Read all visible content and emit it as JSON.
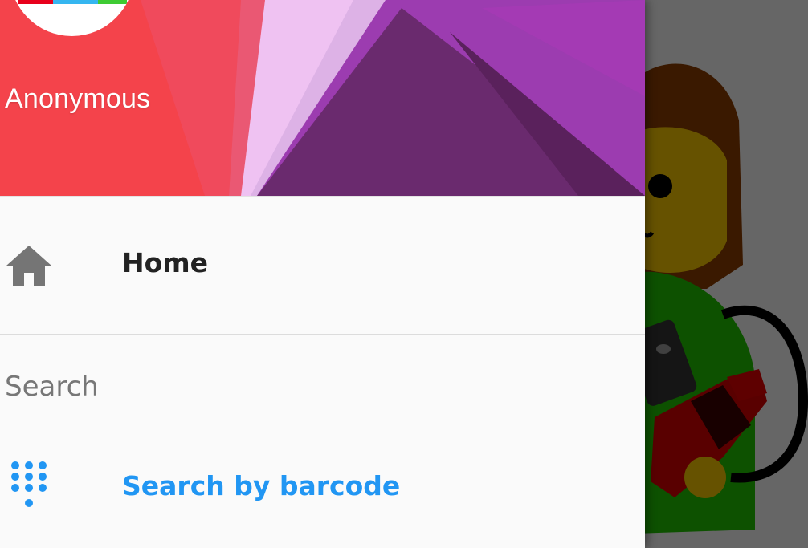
{
  "drawer": {
    "header": {
      "user_name": "Anonymous"
    },
    "items": {
      "home": {
        "label": "Home",
        "icon": "home-icon"
      },
      "search_section": {
        "label": "Search"
      },
      "search_by_barcode": {
        "label": "Search by barcode",
        "icon": "dialpad-icon"
      }
    }
  },
  "colors": {
    "accent": "#2196f3",
    "drawer_bg": "#fafafa",
    "scrim": "#6b6b6b",
    "icon_gray": "#757575"
  }
}
